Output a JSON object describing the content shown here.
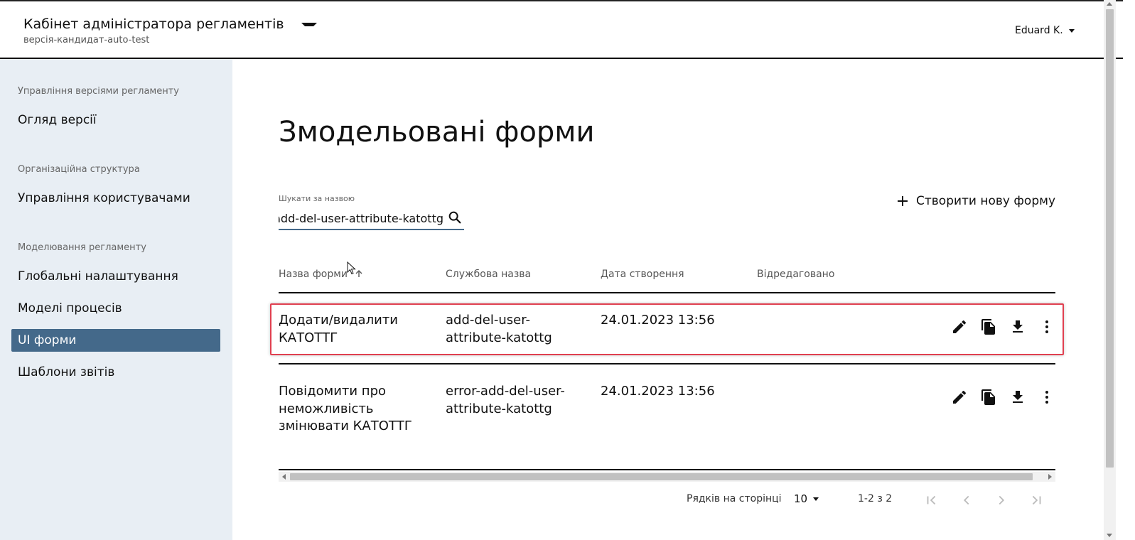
{
  "header": {
    "app_title": "Кабінет адміністратора регламентів",
    "version": "версія-кандидат-auto-test",
    "user": "Eduard K."
  },
  "sidebar": {
    "sections": [
      {
        "title": "Управління версіями регламенту",
        "items": [
          "Огляд версії"
        ]
      },
      {
        "title": "Організаційна структура",
        "items": [
          "Управління користувачами"
        ]
      },
      {
        "title": "Моделювання регламенту",
        "items": [
          "Глобальні налаштування",
          "Моделі процесів",
          "UI форми",
          "Шаблони звітів"
        ]
      }
    ],
    "active_item": "UI форми"
  },
  "main": {
    "page_title": "Змодельовані форми",
    "search": {
      "label": "Шукати за назвою",
      "value": "add-del-user-attribute-katottg"
    },
    "create_button": "Створити нову форму",
    "table": {
      "columns": [
        "Назва форми",
        "Службова назва",
        "Дата створення",
        "Відредаговано"
      ],
      "sort_column": "Назва форми",
      "sort_direction": "ascending",
      "rows": [
        {
          "name": "Додати/видалити КАТОТТГ",
          "code": "add-del-user-attribute-katottg",
          "created": "24.01.2023 13:56",
          "edited": "",
          "highlighted": true
        },
        {
          "name": "Повідомити про неможливість змінювати КАТОТТГ",
          "code": "error-add-del-user-attribute-katottg",
          "created": "24.01.2023 13:56",
          "edited": "",
          "highlighted": false
        }
      ],
      "row_actions": [
        "edit-icon",
        "copy-icon",
        "download-icon",
        "more-vert-icon"
      ]
    },
    "pagination": {
      "rows_per_page_label": "Рядків на сторінці",
      "rows_per_page": "10",
      "range": "1-2 з 2",
      "buttons": [
        "first-page-icon",
        "prev-page-icon",
        "next-page-icon",
        "last-page-icon"
      ]
    }
  },
  "colors": {
    "sidebar_bg": "#e8eef4",
    "active_item_bg": "#44698a",
    "highlight_border": "#e04050"
  }
}
